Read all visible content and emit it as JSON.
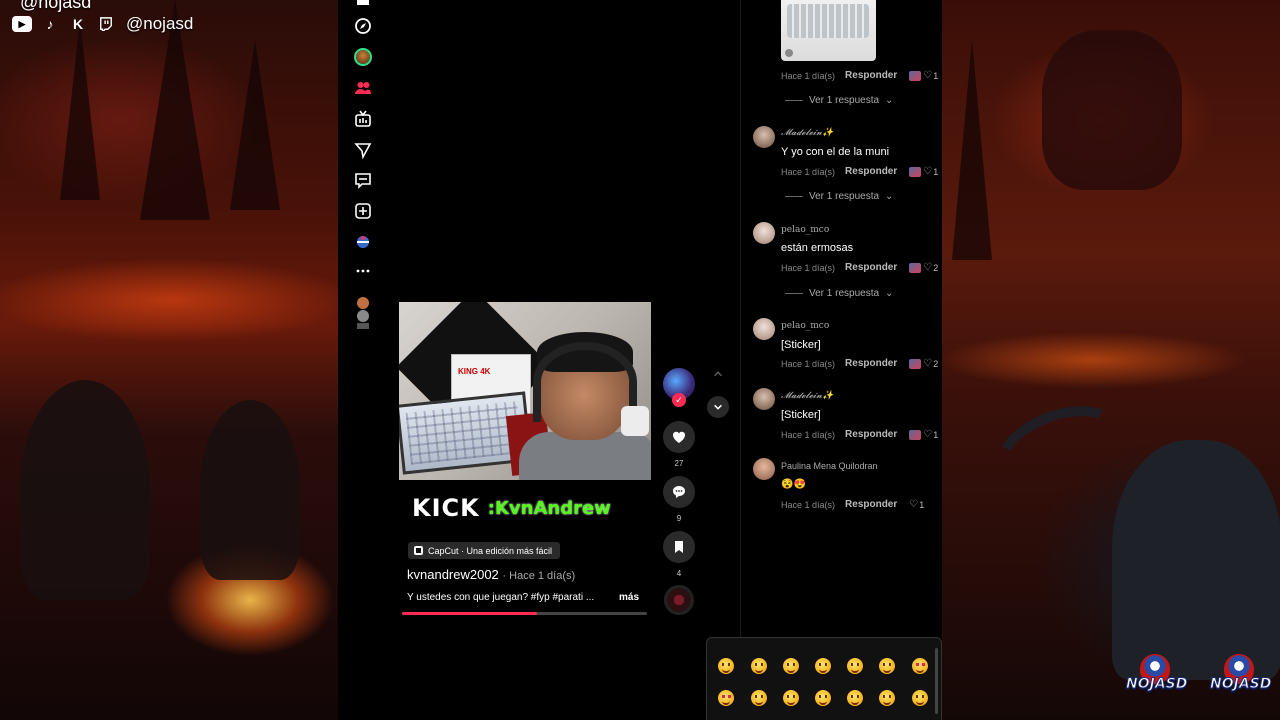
{
  "overlay": {
    "top_handle": "@nojasd",
    "socials_handle": "@nojasd",
    "social_icons": [
      "youtube-icon",
      "tiktok-icon",
      "kick-icon",
      "twitch-icon"
    ],
    "logo_text": "NOJASD"
  },
  "rail": {
    "icons": [
      "home-icon",
      "explore-icon",
      "profile-avatar",
      "following-icon",
      "live-icon",
      "messages-send-icon",
      "inbox-icon",
      "upload-icon",
      "effects-icon",
      "more-icon",
      "friends-avatars"
    ]
  },
  "video": {
    "box_label": "KING 4K",
    "kick_logo": "KICK",
    "kick_handle": ":KvnAndrew",
    "capcut_label": "CapCut · Una edición más fácil",
    "author": "kvnandrew2002",
    "time": "· Hace 1 día(s)",
    "description": "Y ustedes con que juegan? #fyp #parati ...",
    "more": "más",
    "progress": 0.55,
    "colors": {
      "accent": "#fe2c55",
      "kick_green": "#53fc18"
    }
  },
  "actions": {
    "likes": "27",
    "comments": "9",
    "saves": "4",
    "follow": "✓"
  },
  "comments": {
    "reply_label": "Responder",
    "view_reply_label": "Ver 1 respuesta",
    "items": [
      {
        "user": "",
        "text": "",
        "time": "Hace 1 día(s)",
        "likes": "1",
        "has_gif": true
      },
      {
        "user": "𝓜𝓪𝓭𝓮𝓵𝓮𝓲𝓷✨",
        "text": "Y yo con el de la muni",
        "time": "Hace 1 día(s)",
        "likes": "1"
      },
      {
        "user": "pelao_mco",
        "text": "están ermosas",
        "time": "Hace 1 día(s)",
        "likes": "2"
      },
      {
        "user": "pelao_mco",
        "text": "[Sticker]",
        "time": "Hace 1 día(s)",
        "likes": "2"
      },
      {
        "user": "𝓜𝓪𝓭𝓮𝓵𝓮𝓲𝓷✨",
        "text": "[Sticker]",
        "time": "Hace 1 día(s)",
        "likes": "1"
      },
      {
        "user": "Paulina Mena Quilodran",
        "text": "😵😍",
        "time": "Hace 1 día(s)",
        "likes": "1"
      }
    ]
  },
  "emoji_picker": {
    "emojis": [
      "grinning-squint",
      "smile",
      "upside-down",
      "wink",
      "blush",
      "halo",
      "heart-eyes",
      "kiss-heart",
      "kiss",
      "kiss-closed",
      "kiss-smile",
      "yum",
      "tongue",
      "wink-tongue"
    ]
  }
}
